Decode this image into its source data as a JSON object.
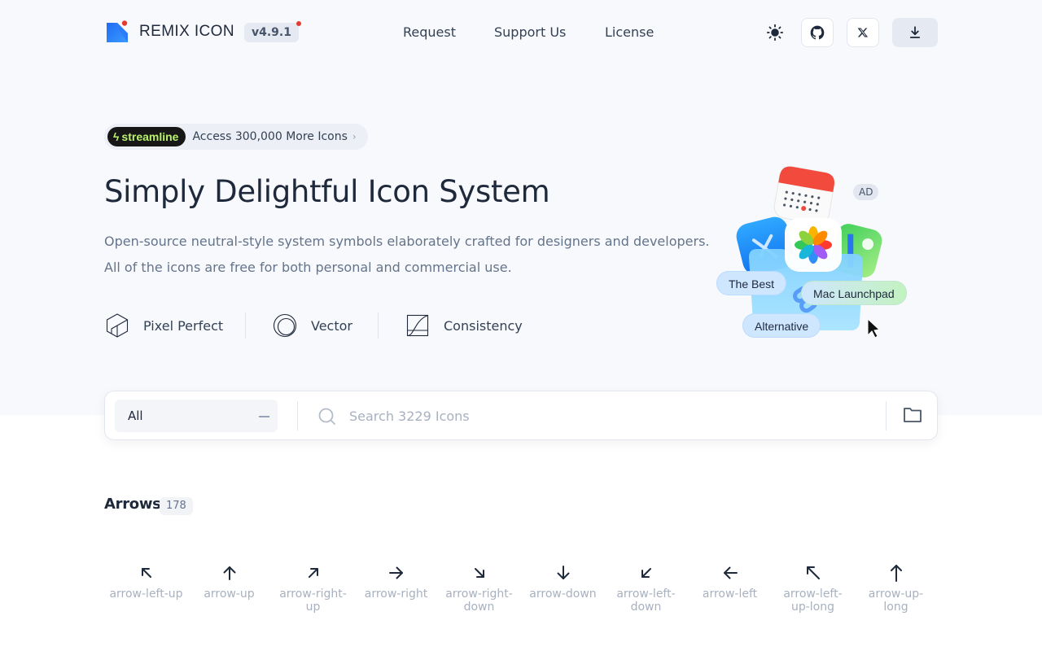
{
  "brand": {
    "name": "REMIX ICON",
    "version": "v4.9.1"
  },
  "nav": [
    {
      "label": "Request"
    },
    {
      "label": "Support Us"
    },
    {
      "label": "License"
    }
  ],
  "promo": {
    "badge": "streamline",
    "text": "Access 300,000 More Icons"
  },
  "hero": {
    "title": "Simply Delightful Icon System",
    "desc_line1": "Open-source neutral-style system symbols elaborately crafted for designers and developers.",
    "desc_line2": "All of the icons are free for both personal and commercial use."
  },
  "features": [
    {
      "label": "Pixel Perfect",
      "icon": "cube-icon"
    },
    {
      "label": "Vector",
      "icon": "circle-icon"
    },
    {
      "label": "Consistency",
      "icon": "curve-icon"
    }
  ],
  "ad": {
    "tag": "AD",
    "pills": [
      "The Best",
      "Mac Launchpad",
      "Alternative"
    ]
  },
  "search": {
    "category": "All",
    "placeholder": "Search 3229 Icons"
  },
  "category": {
    "title": "Arrows",
    "count": "178"
  },
  "icons": [
    {
      "name": "arrow-left-up",
      "dir": "left-up"
    },
    {
      "name": "arrow-up",
      "dir": "up"
    },
    {
      "name": "arrow-right-up",
      "dir": "right-up"
    },
    {
      "name": "arrow-right",
      "dir": "right"
    },
    {
      "name": "arrow-right-down",
      "dir": "right-down"
    },
    {
      "name": "arrow-down",
      "dir": "down"
    },
    {
      "name": "arrow-left-down",
      "dir": "left-down"
    },
    {
      "name": "arrow-left",
      "dir": "left"
    },
    {
      "name": "arrow-left-up-long",
      "dir": "left-up-long"
    },
    {
      "name": "arrow-up-long",
      "dir": "up-long"
    }
  ],
  "colors": {
    "accent_blue": "#2563eb",
    "version_dot": "#e6392f",
    "streamline_green": "#b9f36b"
  }
}
